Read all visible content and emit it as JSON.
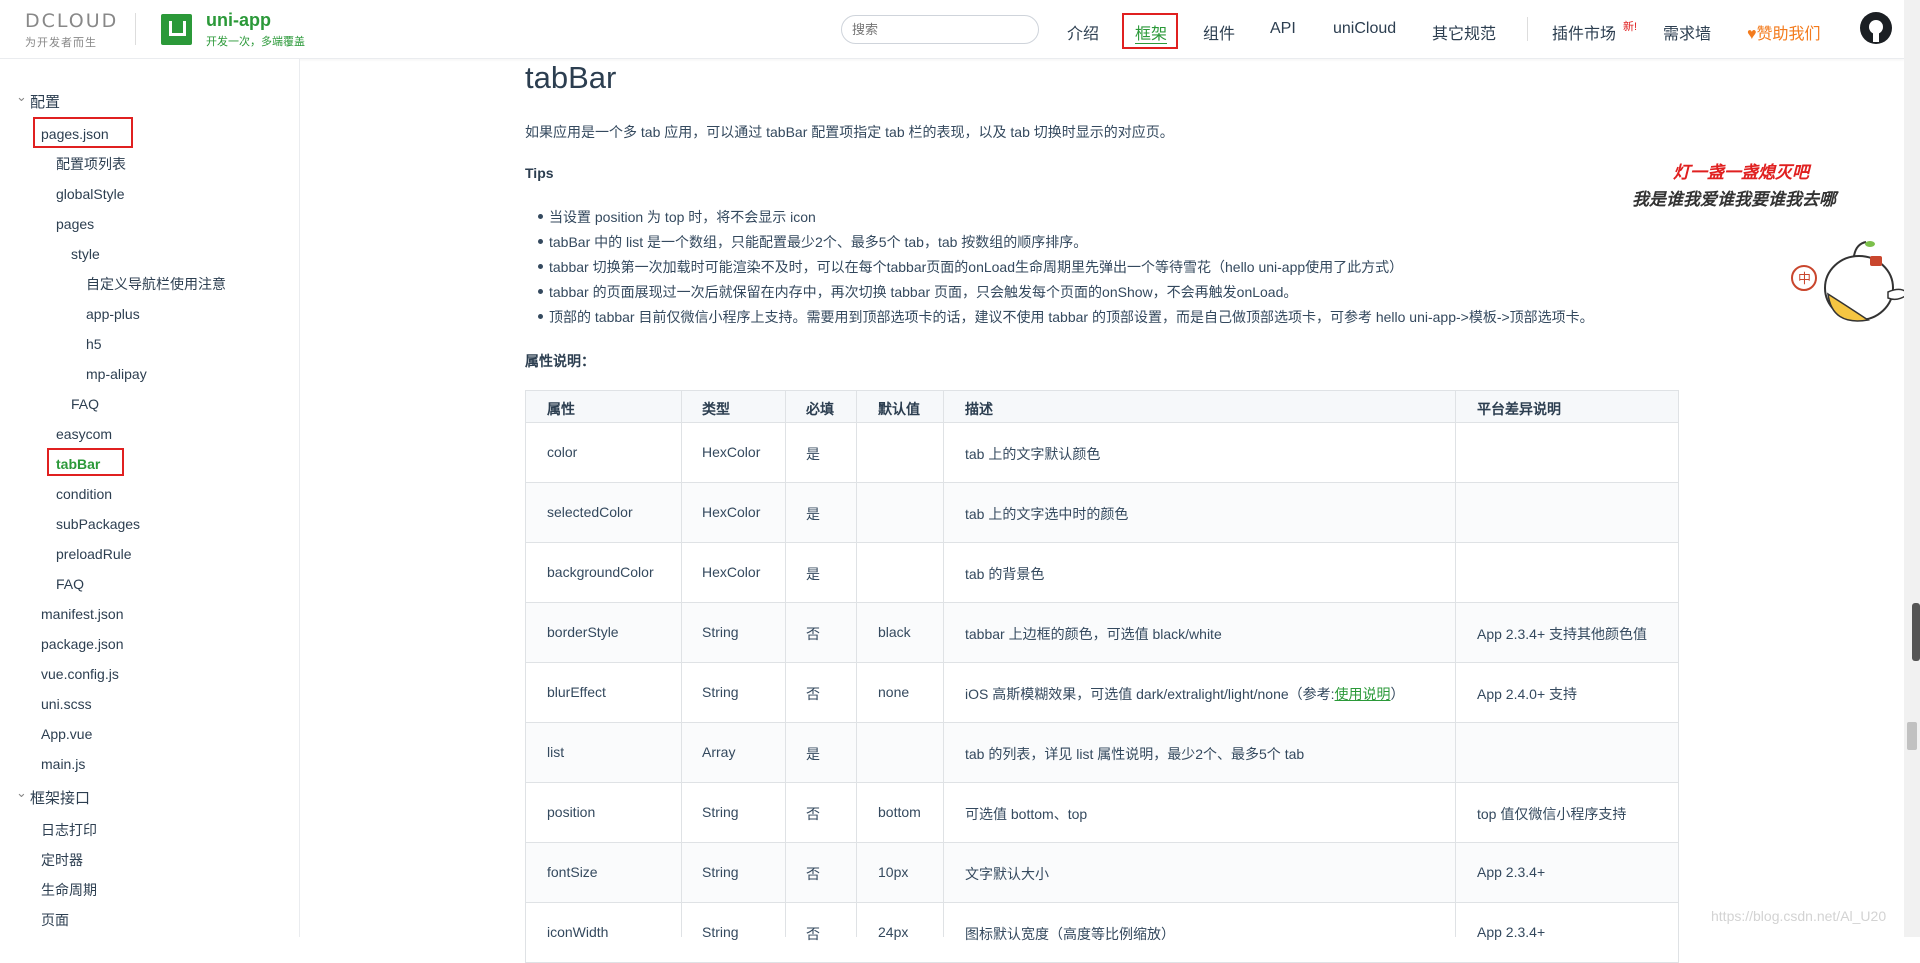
{
  "header": {
    "dcloud_logo": "DCLOUD",
    "dcloud_tagline": "为开发者而生",
    "logo_title": "uni-app",
    "logo_subtitle": "开发一次，多端覆盖",
    "search_placeholder": "搜索",
    "nav": [
      "介绍",
      "框架",
      "组件",
      "API",
      "uniCloud",
      "其它规范",
      "插件市场",
      "需求墙",
      "赞助我们"
    ],
    "nav_active": "框架",
    "new_badge": "新!",
    "accent_color": "#2b9939",
    "highlight_color": "#e02020"
  },
  "sidebar": {
    "groups": [
      {
        "label": "配置",
        "items": [
          {
            "label": "pages.json"
          },
          {
            "label": "配置项列表"
          },
          {
            "label": "globalStyle"
          },
          {
            "label": "pages"
          },
          {
            "label": "style"
          },
          {
            "label": "自定义导航栏使用注意"
          },
          {
            "label": "app-plus"
          },
          {
            "label": "h5"
          },
          {
            "label": "mp-alipay"
          },
          {
            "label": "FAQ"
          },
          {
            "label": "easycom"
          },
          {
            "label": "tabBar"
          },
          {
            "label": "condition"
          },
          {
            "label": "subPackages"
          },
          {
            "label": "preloadRule"
          },
          {
            "label": "FAQ"
          },
          {
            "label": "manifest.json"
          },
          {
            "label": "package.json"
          },
          {
            "label": "vue.config.js"
          },
          {
            "label": "uni.scss"
          },
          {
            "label": "App.vue"
          },
          {
            "label": "main.js"
          }
        ]
      },
      {
        "label": "框架接口",
        "items": [
          {
            "label": "日志打印"
          },
          {
            "label": "定时器"
          },
          {
            "label": "生命周期"
          },
          {
            "label": "页面"
          }
        ]
      }
    ],
    "active_item": "tabBar"
  },
  "main": {
    "title": "tabBar",
    "intro": "如果应用是一个多 tab 应用，可以通过 tabBar 配置项指定 tab 栏的表现，以及 tab 切换时显示的对应页。",
    "tips_heading": "Tips",
    "tips": [
      "当设置 position 为 top 时，将不会显示 icon",
      "tabBar 中的 list 是一个数组，只能配置最少2个、最多5个 tab，tab 按数组的顺序排序。",
      "tabbar 切换第一次加载时可能渲染不及时，可以在每个tabbar页面的onLoad生命周期里先弹出一个等待雪花（hello uni-app使用了此方式）",
      "tabbar 的页面展现过一次后就保留在内存中，再次切换 tabbar 页面，只会触发每个页面的onShow，不会再触发onLoad。",
      "顶部的 tabbar 目前仅微信小程序上支持。需要用到顶部选项卡的话，建议不使用 tabbar 的顶部设置，而是自己做顶部选项卡，可参考 hello uni-app->模板->顶部选项卡。"
    ],
    "props_heading": "属性说明："
  },
  "table": {
    "headers": [
      "属性",
      "类型",
      "必填",
      "默认值",
      "描述",
      "平台差异说明"
    ],
    "rows": [
      {
        "prop": "color",
        "type": "HexColor",
        "required": "是",
        "default": "",
        "desc": "tab 上的文字默认颜色",
        "platform": ""
      },
      {
        "prop": "selectedColor",
        "type": "HexColor",
        "required": "是",
        "default": "",
        "desc": "tab 上的文字选中时的颜色",
        "platform": ""
      },
      {
        "prop": "backgroundColor",
        "type": "HexColor",
        "required": "是",
        "default": "",
        "desc": "tab 的背景色",
        "platform": ""
      },
      {
        "prop": "borderStyle",
        "type": "String",
        "required": "否",
        "default": "black",
        "desc": "tabbar 上边框的颜色，可选值 black/white",
        "platform": "App 2.3.4+ 支持其他颜色值"
      },
      {
        "prop": "blurEffect",
        "type": "String",
        "required": "否",
        "default": "none",
        "desc": "iOS 高斯模糊效果，可选值 dark/extralight/light/none（参考:",
        "desc_link": "使用说明",
        "desc_tail": "）",
        "platform": "App 2.4.0+ 支持"
      },
      {
        "prop": "list",
        "type": "Array",
        "required": "是",
        "default": "",
        "desc": "tab 的列表，详见 list 属性说明，最少2个、最多5个 tab",
        "platform": ""
      },
      {
        "prop": "position",
        "type": "String",
        "required": "否",
        "default": "bottom",
        "desc": "可选值 bottom、top",
        "platform": "top 值仅微信小程序支持"
      },
      {
        "prop": "fontSize",
        "type": "String",
        "required": "否",
        "default": "10px",
        "desc": "文字默认大小",
        "platform": "App 2.3.4+"
      },
      {
        "prop": "iconWidth",
        "type": "String",
        "required": "否",
        "default": "24px",
        "desc": "图标默认宽度（高度等比例缩放）",
        "platform": "App 2.3.4+"
      }
    ]
  },
  "decor": {
    "poem_line1": "灯一盏一盏熄灭吧",
    "poem_line2": "我是谁我爱谁我要谁我去哪",
    "poem_color1": "#e02020",
    "poem_color2": "#333333",
    "mascot_badge": "中",
    "watermark": "https://blog.csdn.net/Al_U20"
  }
}
